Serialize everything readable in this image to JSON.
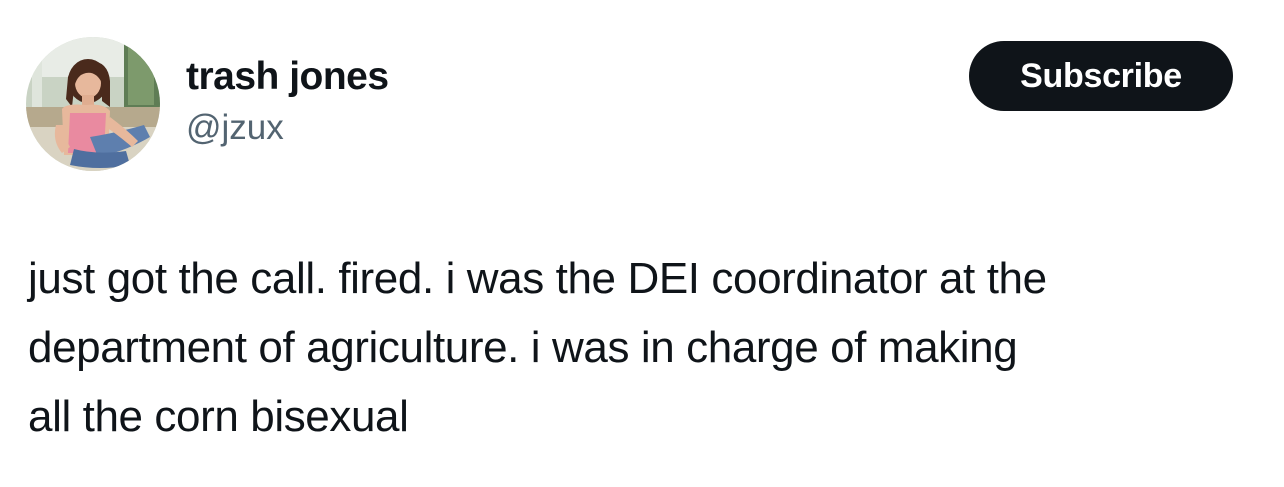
{
  "author": {
    "display_name": "trash jones",
    "handle": "@jzux",
    "avatar_icon": "profile-photo"
  },
  "actions": {
    "subscribe_label": "Subscribe"
  },
  "tweet": {
    "lines": [
      "just got the call. fired. i was the DEI coordinator at the",
      "department of agriculture. i was in charge of making",
      "all the corn bisexual"
    ]
  },
  "colors": {
    "text_primary": "#0f1419",
    "text_secondary": "#536471",
    "button_bg": "#0f1419",
    "button_text": "#ffffff",
    "background": "#ffffff"
  }
}
